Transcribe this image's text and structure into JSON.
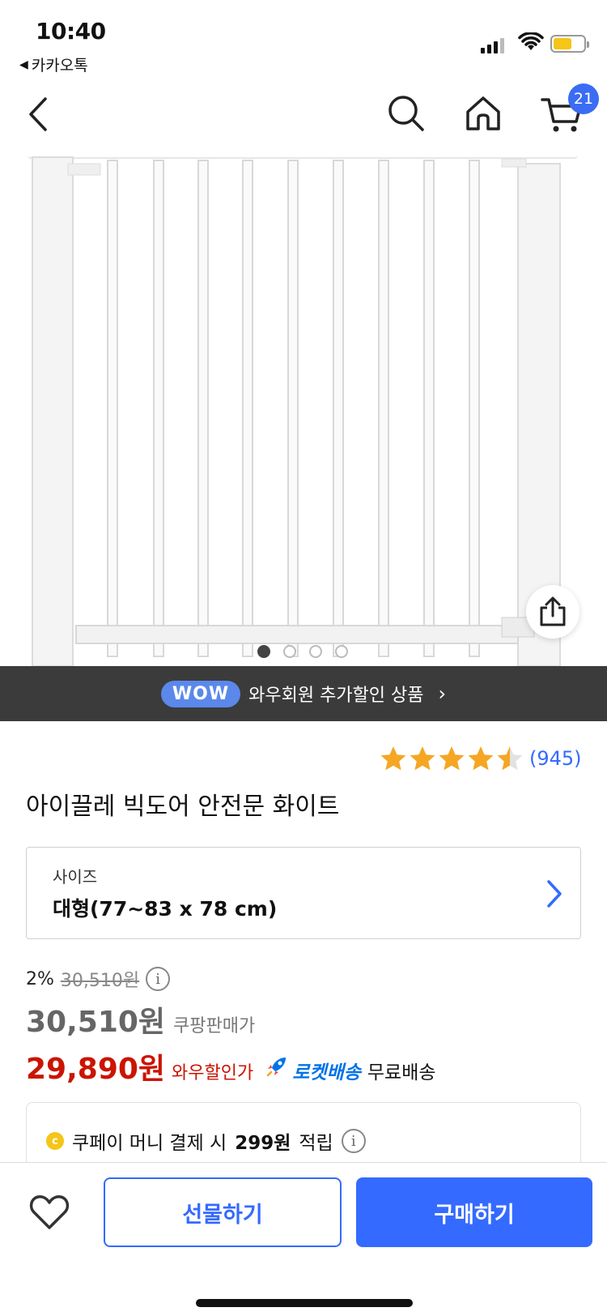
{
  "status_bar": {
    "time": "10:40",
    "back_app": "카카오톡"
  },
  "nav": {
    "cart_count": "21"
  },
  "product_image": {
    "carousel_total": 4,
    "carousel_active": 1
  },
  "wow_banner": {
    "badge": "WOW",
    "text": "와우회원 추가할인 상품",
    "chevron": "›"
  },
  "rating": {
    "stars": 4.5,
    "max_stars": 5,
    "review_count": "(945)"
  },
  "product": {
    "title": "아이끌레 빅도어 안전문 화이트"
  },
  "option": {
    "label": "사이즈",
    "value": "대형(77~83 x 78 cm)"
  },
  "pricing": {
    "discount_rate": "2%",
    "original_price": "30,510원",
    "price": "30,510원",
    "price_label": "쿠팡판매가",
    "wow_price": "29,890원",
    "wow_price_label": "와우할인가",
    "rocket_label": "로켓배송",
    "shipping": "무료배송"
  },
  "coupay": {
    "text_before": "쿠페이 머니 결제 시",
    "amount": "299원",
    "text_after": "적립"
  },
  "bottom_bar": {
    "gift_label": "선물하기",
    "buy_label": "구매하기"
  },
  "colors": {
    "accent_blue": "#346aff",
    "wow_red": "#cb1400",
    "rocket_blue": "#0073e9",
    "banner_dark": "#3b3b3b",
    "star_yellow": "#f5a623"
  },
  "icons": [
    "back-arrow-icon",
    "search-icon",
    "home-icon",
    "cart-icon",
    "share-icon",
    "info-icon",
    "heart-icon",
    "rocket-icon",
    "coin-icon"
  ]
}
